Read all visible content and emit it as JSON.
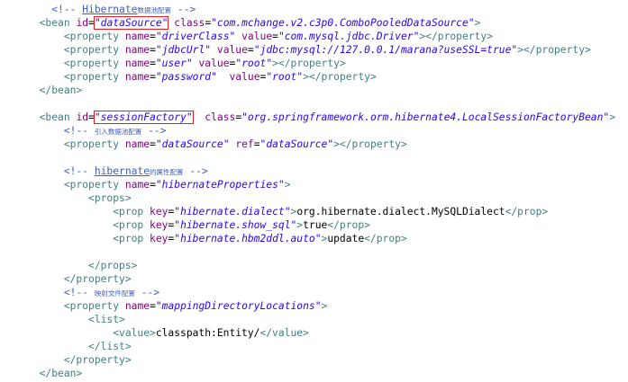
{
  "editor": {
    "lines": [
      [
        {
          "t": "ind",
          "v": "    "
        },
        {
          "t": "com",
          "v": "<!-- "
        },
        {
          "t": "com-ul",
          "v": "Hibernate"
        },
        {
          "t": "com-cjk",
          "v": "数据池配置"
        },
        {
          "t": "com",
          "v": " -->"
        }
      ],
      [
        {
          "t": "ind",
          "v": "  "
        },
        {
          "t": "tag",
          "v": "<bean"
        },
        {
          "t": "txt",
          "v": " "
        },
        {
          "t": "attr",
          "v": "id"
        },
        {
          "t": "eq",
          "v": "="
        },
        {
          "t": "boxed",
          "v": "\"dataSource\""
        },
        {
          "t": "txt",
          "v": " "
        },
        {
          "t": "attr",
          "v": "class"
        },
        {
          "t": "eq",
          "v": "="
        },
        {
          "t": "val",
          "v": "\"com.mchange.v2.c3p0.ComboPooledDataSource\""
        },
        {
          "t": "tag",
          "v": ">"
        }
      ],
      [
        {
          "t": "ind",
          "v": "      "
        },
        {
          "t": "tag",
          "v": "<property"
        },
        {
          "t": "txt",
          "v": " "
        },
        {
          "t": "attr",
          "v": "name"
        },
        {
          "t": "eq",
          "v": "="
        },
        {
          "t": "val",
          "v": "\"driverClass\""
        },
        {
          "t": "txt",
          "v": " "
        },
        {
          "t": "attr",
          "v": "value"
        },
        {
          "t": "eq",
          "v": "="
        },
        {
          "t": "val",
          "v": "\"com.mysql.jdbc.Driver\""
        },
        {
          "t": "tag",
          "v": "></property>"
        }
      ],
      [
        {
          "t": "ind",
          "v": "      "
        },
        {
          "t": "tag",
          "v": "<property"
        },
        {
          "t": "txt",
          "v": " "
        },
        {
          "t": "attr",
          "v": "name"
        },
        {
          "t": "eq",
          "v": "="
        },
        {
          "t": "val",
          "v": "\"jdbcUrl\""
        },
        {
          "t": "txt",
          "v": " "
        },
        {
          "t": "attr",
          "v": "value"
        },
        {
          "t": "eq",
          "v": "="
        },
        {
          "t": "val",
          "v": "\"jdbc:mysql://127.0.0.1/marana?useSSL=true\""
        },
        {
          "t": "tag",
          "v": "></property>"
        }
      ],
      [
        {
          "t": "ind",
          "v": "      "
        },
        {
          "t": "tag",
          "v": "<property"
        },
        {
          "t": "txt",
          "v": " "
        },
        {
          "t": "attr",
          "v": "name"
        },
        {
          "t": "eq",
          "v": "="
        },
        {
          "t": "val",
          "v": "\"user\""
        },
        {
          "t": "txt",
          "v": " "
        },
        {
          "t": "attr",
          "v": "value"
        },
        {
          "t": "eq",
          "v": "="
        },
        {
          "t": "val",
          "v": "\"root\""
        },
        {
          "t": "tag",
          "v": "></property>"
        }
      ],
      [
        {
          "t": "ind",
          "v": "      "
        },
        {
          "t": "tag",
          "v": "<property"
        },
        {
          "t": "txt",
          "v": " "
        },
        {
          "t": "attr",
          "v": "name"
        },
        {
          "t": "eq",
          "v": "="
        },
        {
          "t": "val",
          "v": "\"password\""
        },
        {
          "t": "txt",
          "v": "  "
        },
        {
          "t": "attr",
          "v": "value"
        },
        {
          "t": "eq",
          "v": "="
        },
        {
          "t": "val",
          "v": "\"root\""
        },
        {
          "t": "tag",
          "v": "></property>"
        }
      ],
      [
        {
          "t": "ind",
          "v": "  "
        },
        {
          "t": "tag",
          "v": "</bean>"
        }
      ],
      [],
      [
        {
          "t": "ind",
          "v": "  "
        },
        {
          "t": "tag",
          "v": "<bean"
        },
        {
          "t": "txt",
          "v": " "
        },
        {
          "t": "attr",
          "v": "id"
        },
        {
          "t": "eq",
          "v": "="
        },
        {
          "t": "boxed",
          "v": "\"sessionFactory\""
        },
        {
          "t": "txt",
          "v": "  "
        },
        {
          "t": "attr",
          "v": "class"
        },
        {
          "t": "eq",
          "v": "="
        },
        {
          "t": "val",
          "v": "\"org.springframework.orm.hibernate4.LocalSessionFactoryBean\""
        },
        {
          "t": "tag",
          "v": ">"
        }
      ],
      [
        {
          "t": "ind",
          "v": "      "
        },
        {
          "t": "com",
          "v": "<!-- "
        },
        {
          "t": "com-cjk",
          "v": "引入数据池配置"
        },
        {
          "t": "com",
          "v": " -->"
        }
      ],
      [
        {
          "t": "ind",
          "v": "      "
        },
        {
          "t": "tag",
          "v": "<property"
        },
        {
          "t": "txt",
          "v": " "
        },
        {
          "t": "attr",
          "v": "name"
        },
        {
          "t": "eq",
          "v": "="
        },
        {
          "t": "val",
          "v": "\"dataSource\""
        },
        {
          "t": "txt",
          "v": " "
        },
        {
          "t": "attr",
          "v": "ref"
        },
        {
          "t": "eq",
          "v": "="
        },
        {
          "t": "val",
          "v": "\"dataSource\""
        },
        {
          "t": "tag",
          "v": "></property>"
        }
      ],
      [],
      [
        {
          "t": "ind",
          "v": "      "
        },
        {
          "t": "com",
          "v": "<!-- "
        },
        {
          "t": "com-ul",
          "v": "hibernate"
        },
        {
          "t": "com-cjk",
          "v": "的属性配置"
        },
        {
          "t": "com",
          "v": " -->"
        }
      ],
      [
        {
          "t": "ind",
          "v": "      "
        },
        {
          "t": "tag",
          "v": "<property"
        },
        {
          "t": "txt",
          "v": " "
        },
        {
          "t": "attr",
          "v": "name"
        },
        {
          "t": "eq",
          "v": "="
        },
        {
          "t": "val",
          "v": "\"hibernateProperties\""
        },
        {
          "t": "tag",
          "v": ">"
        }
      ],
      [
        {
          "t": "ind",
          "v": "          "
        },
        {
          "t": "tag",
          "v": "<props>"
        }
      ],
      [
        {
          "t": "ind",
          "v": "              "
        },
        {
          "t": "tag",
          "v": "<prop"
        },
        {
          "t": "txt",
          "v": " "
        },
        {
          "t": "attr",
          "v": "key"
        },
        {
          "t": "eq",
          "v": "="
        },
        {
          "t": "val",
          "v": "\"hibernate.dialect\""
        },
        {
          "t": "tag",
          "v": ">"
        },
        {
          "t": "txt",
          "v": "org.hibernate.dialect.MySQLDialect"
        },
        {
          "t": "tag",
          "v": "</prop>"
        }
      ],
      [
        {
          "t": "ind",
          "v": "              "
        },
        {
          "t": "tag",
          "v": "<prop"
        },
        {
          "t": "txt",
          "v": " "
        },
        {
          "t": "attr",
          "v": "key"
        },
        {
          "t": "eq",
          "v": "="
        },
        {
          "t": "val",
          "v": "\"hibernate.show_sql\""
        },
        {
          "t": "tag",
          "v": ">"
        },
        {
          "t": "txt",
          "v": "true"
        },
        {
          "t": "tag",
          "v": "</prop>"
        }
      ],
      [
        {
          "t": "ind",
          "v": "              "
        },
        {
          "t": "tag",
          "v": "<prop"
        },
        {
          "t": "txt",
          "v": " "
        },
        {
          "t": "attr",
          "v": "key"
        },
        {
          "t": "eq",
          "v": "="
        },
        {
          "t": "val",
          "v": "\"hibernate.hbm2ddl.auto\""
        },
        {
          "t": "tag",
          "v": ">"
        },
        {
          "t": "txt",
          "v": "update"
        },
        {
          "t": "tag",
          "v": "</prop>"
        }
      ],
      [],
      [
        {
          "t": "ind",
          "v": "          "
        },
        {
          "t": "tag",
          "v": "</props>"
        }
      ],
      [
        {
          "t": "ind",
          "v": "      "
        },
        {
          "t": "tag",
          "v": "</property>"
        }
      ],
      [
        {
          "t": "ind",
          "v": "      "
        },
        {
          "t": "com",
          "v": "<!-- "
        },
        {
          "t": "com-cjk",
          "v": "映射文件配置"
        },
        {
          "t": "com",
          "v": " -->"
        }
      ],
      [
        {
          "t": "ind",
          "v": "      "
        },
        {
          "t": "tag",
          "v": "<property"
        },
        {
          "t": "txt",
          "v": " "
        },
        {
          "t": "attr",
          "v": "name"
        },
        {
          "t": "eq",
          "v": "="
        },
        {
          "t": "val",
          "v": "\"mappingDirectoryLocations\""
        },
        {
          "t": "tag",
          "v": ">"
        }
      ],
      [
        {
          "t": "ind",
          "v": "          "
        },
        {
          "t": "tag",
          "v": "<list>"
        }
      ],
      [
        {
          "t": "ind",
          "v": "              "
        },
        {
          "t": "tag",
          "v": "<value>"
        },
        {
          "t": "txt",
          "v": "classpath:Entity/"
        },
        {
          "t": "tag",
          "v": "</value>"
        }
      ],
      [
        {
          "t": "ind",
          "v": "          "
        },
        {
          "t": "tag",
          "v": "</list>"
        }
      ],
      [
        {
          "t": "ind",
          "v": "      "
        },
        {
          "t": "tag",
          "v": "</property>"
        }
      ],
      [
        {
          "t": "ind",
          "v": "  "
        },
        {
          "t": "tag",
          "v": "</bean>"
        }
      ]
    ]
  },
  "colors": {
    "comment": "#3f5fbf",
    "tag": "#3f7f7f",
    "attribute": "#7f007f",
    "value": "#2a00ff",
    "text": "#000000",
    "highlight_box": "#e02020",
    "background": "#ffffff"
  }
}
